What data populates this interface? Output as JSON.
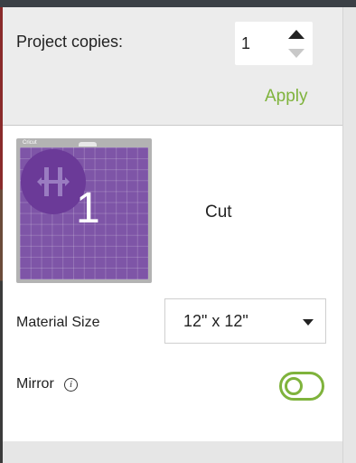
{
  "copies": {
    "label": "Project copies:",
    "value": "1",
    "apply_label": "Apply"
  },
  "mat": {
    "brand": "Cricut",
    "number": "1",
    "label": "Cut",
    "color": "#7e55a7"
  },
  "material": {
    "label": "Material Size",
    "value": "12\" x 12\""
  },
  "mirror": {
    "label": "Mirror",
    "info_glyph": "i",
    "enabled": false,
    "accent": "#7fb33c"
  },
  "icons": [
    "stepper-up-icon",
    "stepper-down-icon",
    "chevron-down-icon",
    "info-icon",
    "toggle-switch"
  ]
}
